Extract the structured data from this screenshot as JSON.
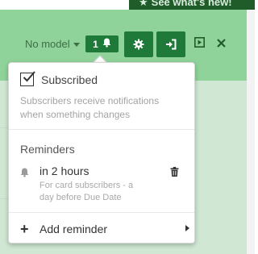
{
  "banner": {
    "text": "See what's new!",
    "icon": "star-icon"
  },
  "toolbar": {
    "model_label": "No model",
    "subscriber_count": "1",
    "buttons": [
      "gear-icon",
      "sign-in-icon",
      "play-icon",
      "close-icon"
    ]
  },
  "popover": {
    "subscribed_label": "Subscribed",
    "subscribed_checked": true,
    "subscribed_description": "Subscribers receive notifications when something changes",
    "reminders_heading": "Reminders",
    "reminders": [
      {
        "title": "in 2 hours",
        "description": "For card subscribers - a day before Due Date"
      }
    ],
    "add_reminder_label": "Add reminder"
  },
  "colors": {
    "header": "#8fd39a",
    "button": "#1f7a3a",
    "banner": "#1f5c2a"
  }
}
